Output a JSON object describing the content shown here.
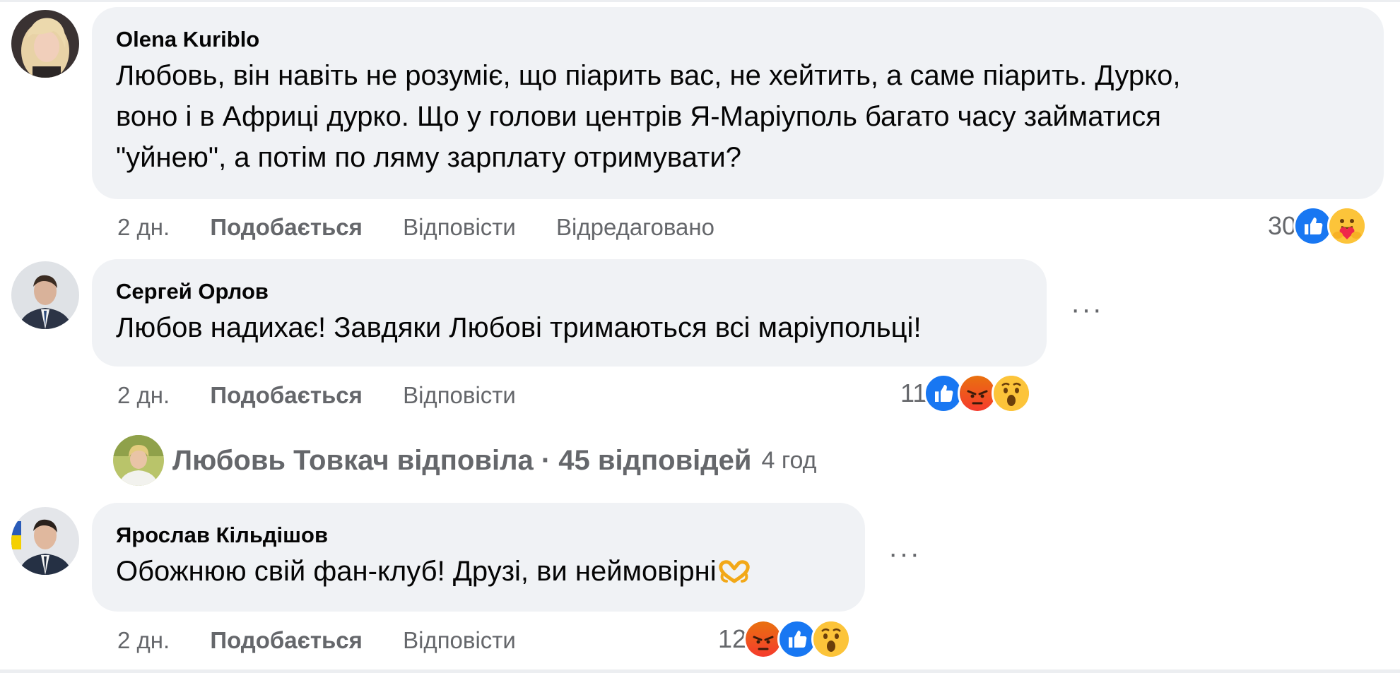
{
  "comments": [
    {
      "author": "Olena Kuriblo",
      "lines": [
        "Любовь, він навіть не розуміє, що піарить вас, не хейтить, а саме піарить. Дурко,",
        "воно і в Африці дурко. Що у голови центрів Я-Маріуполь багато часу займатися",
        "\"уйнею\", а потім по ляму зарплату отримувати?"
      ],
      "time": "2 дн.",
      "like": "Подобається",
      "reply": "Відповісти",
      "edited": "Відредаговано",
      "reaction_count": "30",
      "reactions": [
        "like-icon",
        "care-icon"
      ]
    },
    {
      "author": "Сергей Орлов",
      "lines": [
        "Любов надихає! Завдяки Любові тримаються всі маріупольці!"
      ],
      "time": "2 дн.",
      "like": "Подобається",
      "reply": "Відповісти",
      "reaction_count": "11",
      "reactions": [
        "like-icon",
        "angry-icon",
        "wow-icon"
      ],
      "more": "···"
    },
    {
      "author": "Ярослав Кільдішов",
      "lines": [
        "Обожнюю свій фан-клуб! Друзі, ви неймовірні"
      ],
      "emoji": "heart-hands-emoji",
      "time": "2 дн.",
      "like": "Подобається",
      "reply": "Відповісти",
      "reaction_count": "12",
      "reactions": [
        "angry-icon",
        "like-icon",
        "wow-icon"
      ],
      "more": "···"
    }
  ],
  "replies_summary": {
    "text": "Любовь Товкач відповіла · 45 відповідей",
    "time": "4 год"
  },
  "colors": {
    "bubble_bg": "#f0f2f5",
    "secondary_text": "#65676b",
    "like_blue": "#1877f2",
    "angry_top": "#e9710f",
    "angry_bottom": "#f53b2d",
    "wow_yellow": "#fcc43a"
  }
}
